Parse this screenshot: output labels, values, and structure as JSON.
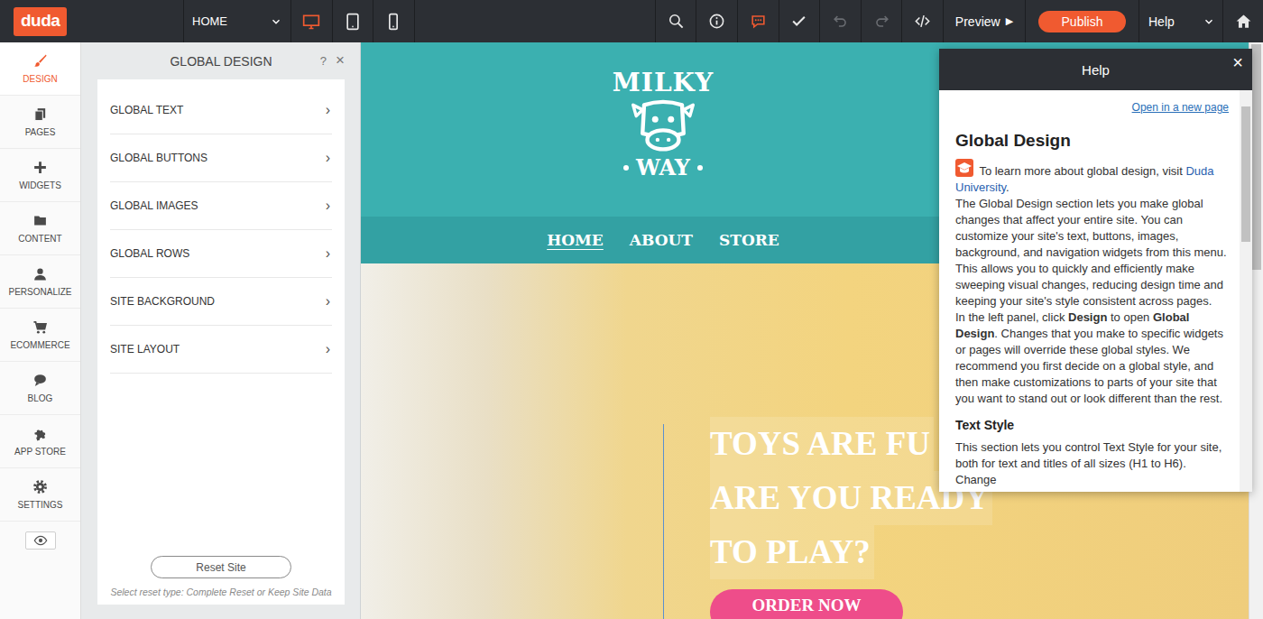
{
  "topbar": {
    "logo": "duda",
    "page_select": "HOME",
    "devices": [
      {
        "kind": "desktop",
        "selected": true
      },
      {
        "kind": "tablet",
        "selected": false
      },
      {
        "kind": "phone",
        "selected": false
      }
    ],
    "tools": [
      {
        "kind": "search",
        "active": false,
        "disabled": false
      },
      {
        "kind": "info",
        "active": false,
        "disabled": false
      },
      {
        "kind": "chat",
        "active": true,
        "disabled": false
      },
      {
        "kind": "check",
        "active": false,
        "disabled": false
      },
      {
        "kind": "undo",
        "active": false,
        "disabled": true
      },
      {
        "kind": "redo",
        "active": false,
        "disabled": true
      },
      {
        "kind": "code",
        "active": false,
        "disabled": false
      }
    ],
    "preview": {
      "label": "Preview",
      "icon": "▶"
    },
    "publish": "Publish",
    "help_menu": "Help"
  },
  "sidebar": {
    "items": [
      {
        "label": "DESIGN",
        "kind": "brush",
        "selected": true
      },
      {
        "label": "PAGES",
        "kind": "pages",
        "selected": false
      },
      {
        "label": "WIDGETS",
        "kind": "plus",
        "selected": false
      },
      {
        "label": "CONTENT",
        "kind": "folder",
        "selected": false
      },
      {
        "label": "PERSONALIZE",
        "kind": "person",
        "selected": false
      },
      {
        "label": "ECOMMERCE",
        "kind": "cart",
        "selected": false
      },
      {
        "label": "BLOG",
        "kind": "bubble",
        "selected": false
      },
      {
        "label": "APP STORE",
        "kind": "puzzle",
        "selected": false
      },
      {
        "label": "SETTINGS",
        "kind": "gear",
        "selected": false
      }
    ]
  },
  "panel": {
    "title": "GLOBAL DESIGN",
    "help": "?",
    "close": "×",
    "chevron": "›",
    "items": [
      "GLOBAL TEXT",
      "GLOBAL BUTTONS",
      "GLOBAL IMAGES",
      "GLOBAL ROWS",
      "SITE BACKGROUND",
      "SITE LAYOUT"
    ],
    "reset_button": "Reset Site",
    "reset_caption": "Select reset type: Complete Reset or Keep Site Data"
  },
  "site": {
    "logo_top": "MILKY",
    "logo_bottom": "WAY",
    "nav": [
      {
        "label": "HOME",
        "selected": true
      },
      {
        "label": "ABOUT",
        "selected": false
      },
      {
        "label": "STORE",
        "selected": false
      }
    ],
    "hero_lines": [
      "TOYS ARE FU",
      "ARE YOU READY",
      "TO PLAY?"
    ],
    "cta": "ORDER NOW"
  },
  "help": {
    "title": "Help",
    "close": "×",
    "open_link": "Open in a new page",
    "heading": "Global Design",
    "intro": [
      {
        "text": "To learn more about global design, visit ",
        "link": false
      },
      {
        "text": "Duda University",
        "link": true
      },
      {
        "text": ".",
        "link": false
      }
    ],
    "paragraphs": [
      [
        {
          "text": "The Global Design section lets you make global changes that affect your entire site. You can customize your site's text, buttons, images, background, and navigation widgets from this menu. This allows you to quickly and efficiently make sweeping visual changes, reducing design time and keeping your site's style consistent across pages.",
          "bold": false
        }
      ],
      [
        {
          "text": "In the left panel, click ",
          "bold": false
        },
        {
          "text": "Design",
          "bold": true
        },
        {
          "text": " to open ",
          "bold": false
        },
        {
          "text": "Global Design",
          "bold": true
        },
        {
          "text": ". Changes that you make to specific widgets or pages will override these global styles. We recommend you first decide on a global style, and then make customizations to parts of your site that you want to stand out or look different than the rest.",
          "bold": false
        }
      ]
    ],
    "section": {
      "heading": "Text Style",
      "text": "This section lets you control Text Style for your site, both for text and titles of all sizes (H1 to H6). Change"
    }
  }
}
